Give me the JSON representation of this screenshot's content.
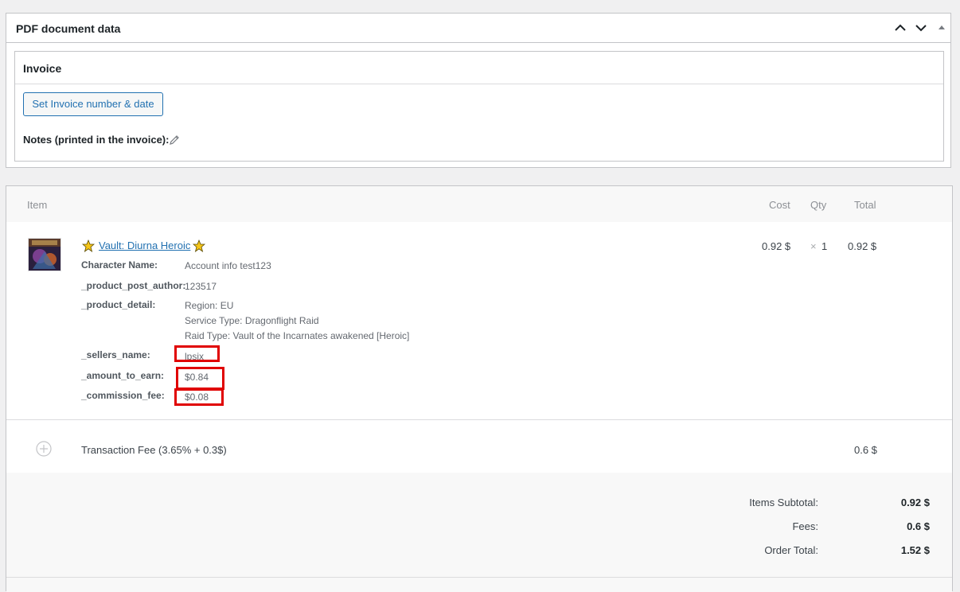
{
  "pdf_box": {
    "title": "PDF document data",
    "invoice": {
      "title": "Invoice",
      "set_button": "Set Invoice number & date",
      "notes_label": "Notes (printed in the invoice):"
    }
  },
  "items": {
    "headers": {
      "item": "Item",
      "cost": "Cost",
      "qty": "Qty",
      "total": "Total"
    },
    "product": {
      "name": "Vault: Diurna Heroic",
      "cost": "0.92 $",
      "qty_sep": "×",
      "qty": "1",
      "total": "0.92 $",
      "meta": [
        {
          "key": "Character Name:",
          "value": "Account info test123"
        },
        {
          "key": "_product_post_author:",
          "value": "123517"
        },
        {
          "key": "_product_detail:",
          "lines": [
            "Region: EU",
            "Service Type: Dragonflight Raid",
            "Raid Type: Vault of the Incarnates awakened [Heroic]"
          ]
        },
        {
          "key": "_sellers_name:",
          "value": "lpsix"
        },
        {
          "key": "_amount_to_earn:",
          "value": "$0.84"
        },
        {
          "key": "_commission_fee:",
          "value": "$0.08"
        }
      ]
    },
    "fee": {
      "label": "Transaction Fee (3.65% + 0.3$)",
      "total": "0.6 $"
    },
    "totals": {
      "subtotal_label": "Items Subtotal:",
      "subtotal": "0.92 $",
      "fees_label": "Fees:",
      "fees": "0.6 $",
      "order_label": "Order Total:",
      "order": "1.52 $"
    }
  },
  "colors": {
    "link": "#2271b1",
    "highlight": "#e00000",
    "border": "#c3c4c7"
  }
}
